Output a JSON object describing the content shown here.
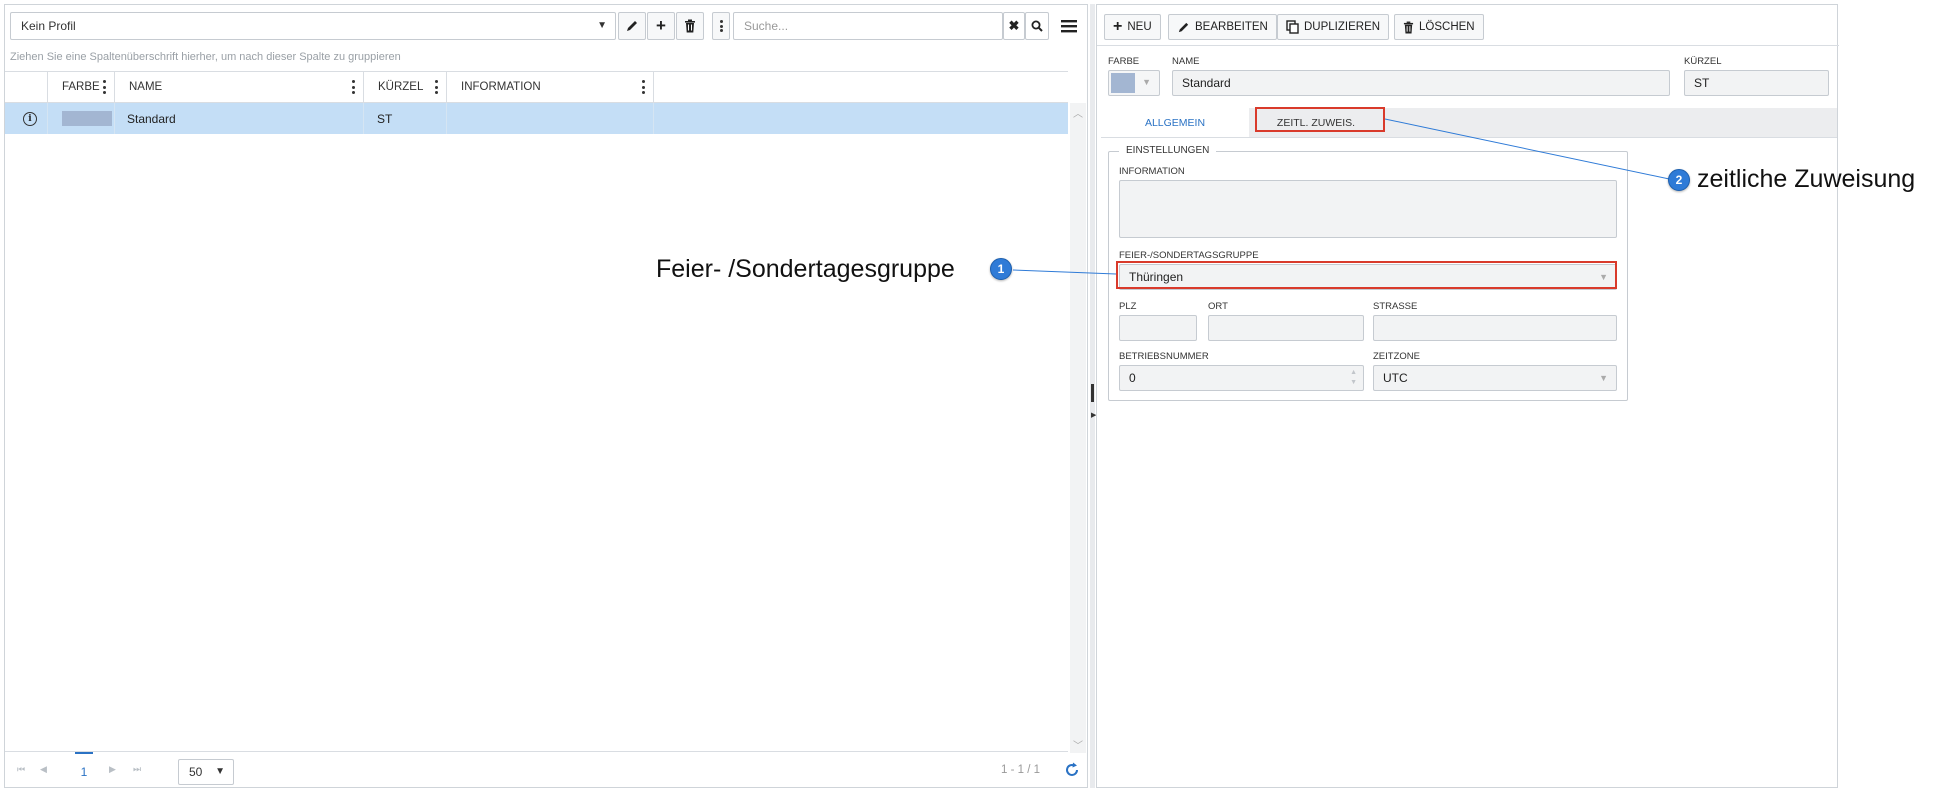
{
  "toolbar": {
    "profile_value": "Kein Profil",
    "search_placeholder": "Suche..."
  },
  "grid": {
    "group_hint": "Ziehen Sie eine Spaltenüberschrift hierher, um nach dieser Spalte zu gruppieren",
    "columns": [
      "FARBE",
      "NAME",
      "KÜRZEL",
      "INFORMATION"
    ],
    "rows": [
      {
        "farbe": "#a3b6d2",
        "name": "Standard",
        "kuerzel": "ST",
        "information": ""
      }
    ]
  },
  "pager": {
    "current_page": "1",
    "page_size": "50",
    "range_info": "1 - 1 / 1"
  },
  "actions": {
    "new_label": "NEU",
    "edit_label": "BEARBEITEN",
    "duplicate_label": "DUPLIZIEREN",
    "delete_label": "LÖSCHEN"
  },
  "detail": {
    "farbe_label": "FARBE",
    "farbe_value": "#a3b6d2",
    "name_label": "NAME",
    "name_value": "Standard",
    "kuerzel_label": "KÜRZEL",
    "kuerzel_value": "ST",
    "tabs": [
      "ALLGEMEIN",
      "ZEITL. ZUWEIS."
    ],
    "fieldset_legend": "EINSTELLUNGEN",
    "information_label": "INFORMATION",
    "information_value": "",
    "feiertag_label": "FEIER-/SONDERTAGSGRUPPE",
    "feiertag_value": "Thüringen",
    "plz_label": "PLZ",
    "plz_value": "",
    "ort_label": "ORT",
    "ort_value": "",
    "strasse_label": "STRAßE",
    "strasse_value": "",
    "betriebsnummer_label": "BETRIEBSNUMMER",
    "betriebsnummer_value": "0",
    "zeitzone_label": "ZEITZONE",
    "zeitzone_value": "UTC"
  },
  "annotations": [
    {
      "number": "1",
      "text": "Feier- /Sondertagesgruppe"
    },
    {
      "number": "2",
      "text": "zeitliche Zuweisung"
    }
  ],
  "colors": {
    "accent": "#2a72c4",
    "selected_row": "#c4def6",
    "highlight": "#d93a2b",
    "badge": "#2f7bd7"
  }
}
